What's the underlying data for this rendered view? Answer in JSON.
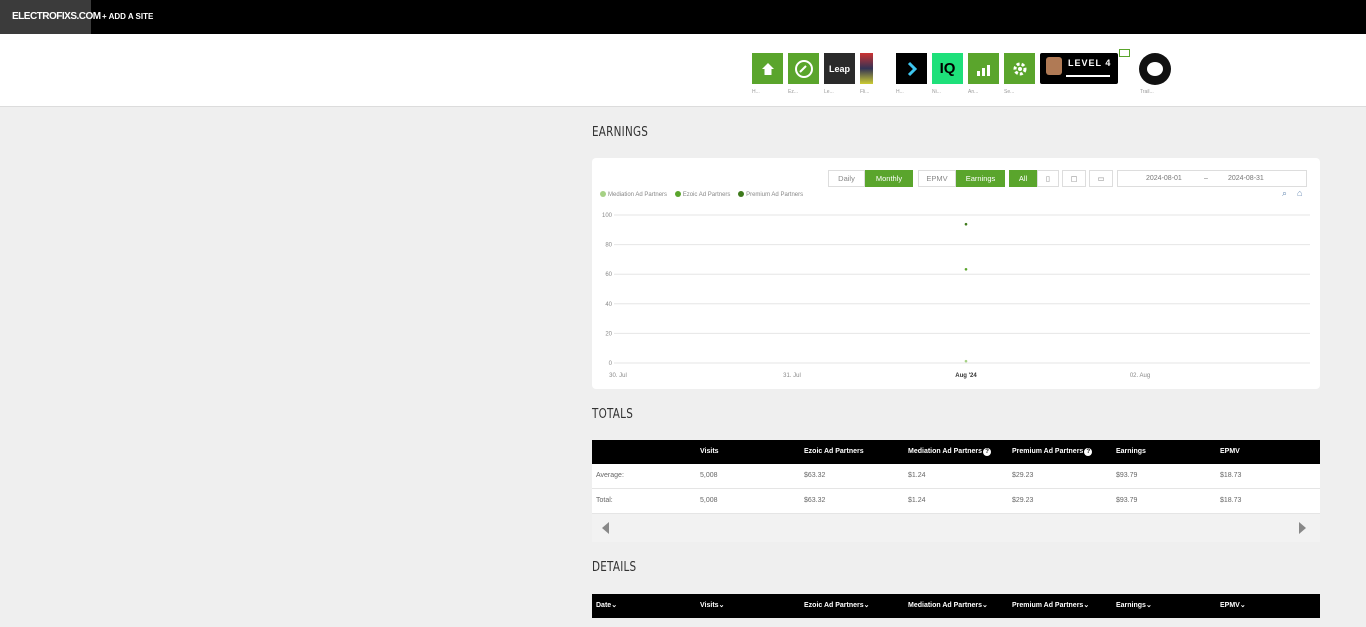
{
  "topbar": {
    "logo": "ELECTROFIXS.COM",
    "add_site": "+ ADD A SITE"
  },
  "apps": [
    {
      "icon": "home-icon",
      "label": "H..."
    },
    {
      "icon": "speedometer-icon",
      "label": "Ez..."
    },
    {
      "icon": "leap-icon",
      "text": "Leap",
      "label": "Le..."
    },
    {
      "icon": "flying-carpet-icon",
      "label": "Fli..."
    },
    {
      "icon": "chevron-right-icon",
      "label": "H..."
    },
    {
      "icon": "iq-icon",
      "text": "IQ",
      "label": "Ni..."
    },
    {
      "icon": "analytics-icon",
      "label": "An..."
    },
    {
      "icon": "gear-icon",
      "label": "Se..."
    }
  ],
  "level": {
    "text": "LEVEL 4"
  },
  "profile": {
    "label": "Trail..."
  },
  "earnings": {
    "title": "EARNINGS",
    "period_buttons": [
      "Daily",
      "Monthly"
    ],
    "metric_buttons": [
      "EPMV",
      "Earnings"
    ],
    "device_buttons": [
      "All"
    ],
    "date_from": "2024-08-01",
    "date_sep": "–",
    "date_to": "2024-08-31"
  },
  "chart_data": {
    "type": "scatter",
    "x": [
      "Aug '24"
    ],
    "series": [
      {
        "name": "Mediation Ad Partners",
        "color": "#a6d185",
        "values": [
          1.24
        ]
      },
      {
        "name": "Ezoic Ad Partners",
        "color": "#5aa52c",
        "values": [
          63.32
        ]
      },
      {
        "name": "Premium Ad Partners",
        "color": "#3e7a1c",
        "values": [
          93.79
        ]
      }
    ],
    "x_ticks": [
      "30. Jul",
      "31. Jul",
      "Aug '24",
      "02. Aug"
    ],
    "y_ticks": [
      "0",
      "20",
      "40",
      "60",
      "80",
      "100"
    ],
    "ylim": [
      0,
      100
    ]
  },
  "totals": {
    "title": "TOTALS",
    "headers": [
      "Visits",
      "Ezoic Ad Partners",
      "Mediation Ad Partners",
      "Premium Ad Partners",
      "Earnings",
      "EPMV"
    ],
    "rows": [
      {
        "label": "Average:",
        "cells": [
          "5,008",
          "$63.32",
          "$1.24",
          "$29.23",
          "$93.79",
          "$18.73"
        ]
      },
      {
        "label": "Total:",
        "cells": [
          "5,008",
          "$63.32",
          "$1.24",
          "$29.23",
          "$93.79",
          "$18.73"
        ]
      }
    ]
  },
  "details": {
    "title": "DETAILS",
    "headers": [
      "Date",
      "Visits",
      "Ezoic Ad Partners",
      "Mediation Ad Partners",
      "Premium Ad Partners",
      "Earnings",
      "EPMV"
    ]
  }
}
